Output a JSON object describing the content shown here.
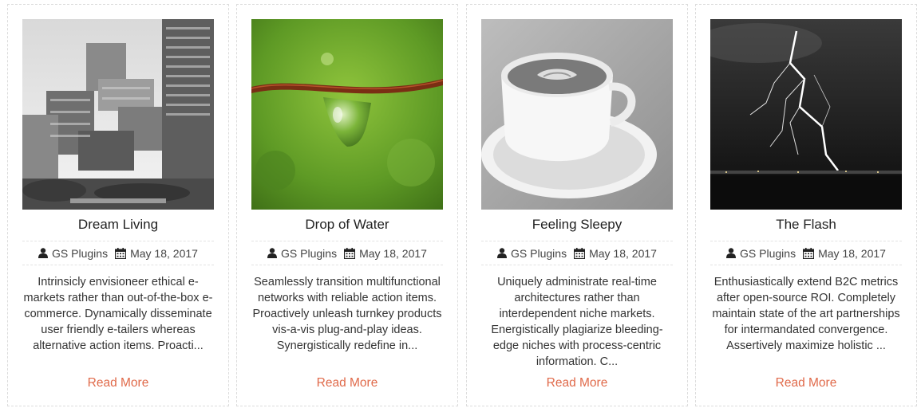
{
  "posts": [
    {
      "title": "Dream Living",
      "author": "GS Plugins",
      "date": "May 18, 2017",
      "excerpt": "Intrinsicly envisioneer ethical e-markets rather than out-of-the-box e-commerce. Dynamically disseminate user friendly e-tailers whereas alternative action items. Proacti...",
      "read_more": "Read More",
      "image": "building-photo"
    },
    {
      "title": "Drop of Water",
      "author": "GS Plugins",
      "date": "May 18, 2017",
      "excerpt": "Seamlessly transition multifunctional networks with reliable action items. Proactively unleash turnkey products vis-a-vis plug-and-play ideas. Synergistically redefine in...",
      "read_more": "Read More",
      "image": "water-drop-photo"
    },
    {
      "title": "Feeling Sleepy",
      "author": "GS Plugins",
      "date": "May 18, 2017",
      "excerpt": "Uniquely administrate real-time architectures rather than interdependent niche markets. Energistically plagiarize bleeding-edge niches with process-centric information. C...",
      "read_more": "Read More",
      "image": "coffee-cup-photo"
    },
    {
      "title": "The Flash",
      "author": "GS Plugins",
      "date": "May 18, 2017",
      "excerpt": "Enthusiastically extend B2C metrics after open-source ROI. Completely maintain state of the art partnerships for intermandated convergence. Assertively maximize holistic ...",
      "read_more": "Read More",
      "image": "lightning-photo"
    }
  ],
  "icons": {
    "author": "user-icon",
    "date": "calendar-icon"
  },
  "colors": {
    "accent": "#e06a4a",
    "text": "#333333",
    "border": "#dcdcdc"
  }
}
